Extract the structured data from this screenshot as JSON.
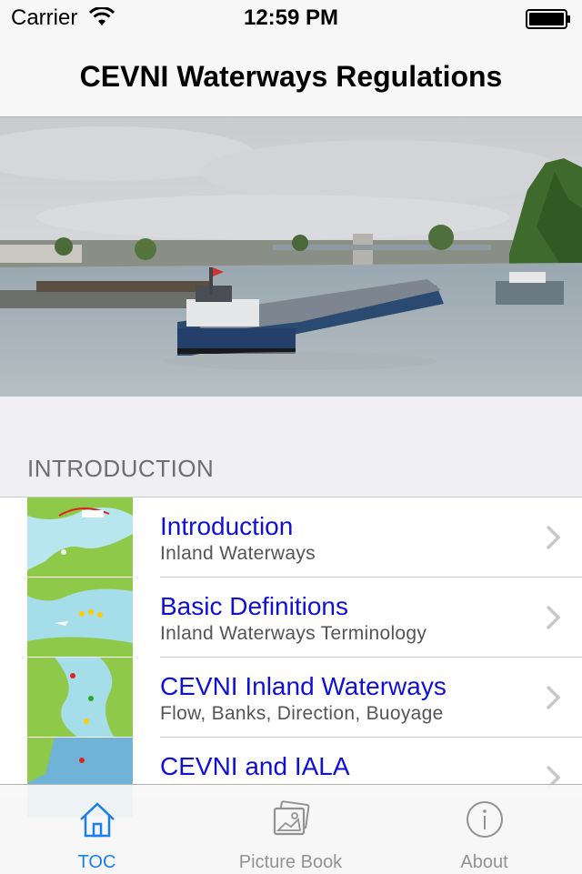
{
  "status_bar": {
    "carrier": "Carrier",
    "time": "12:59 PM"
  },
  "nav": {
    "title": "CEVNI Waterways Regulations"
  },
  "section": {
    "header": "INTRODUCTION"
  },
  "rows": [
    {
      "title": "Introduction",
      "subtitle": "Inland Waterways"
    },
    {
      "title": "Basic Definitions",
      "subtitle": "Inland Waterways Terminology"
    },
    {
      "title": "CEVNI Inland Waterways",
      "subtitle": "Flow, Banks, Direction, Buoyage"
    },
    {
      "title": "CEVNI and IALA",
      "subtitle": ""
    }
  ],
  "tabs": [
    {
      "label": "TOC",
      "icon": "house-icon",
      "active": true
    },
    {
      "label": "Picture Book",
      "icon": "photos-icon",
      "active": false
    },
    {
      "label": "About",
      "icon": "info-icon",
      "active": false
    }
  ],
  "colors": {
    "accent": "#1a7ff0",
    "link": "#1010d4",
    "inactive": "#929292"
  }
}
